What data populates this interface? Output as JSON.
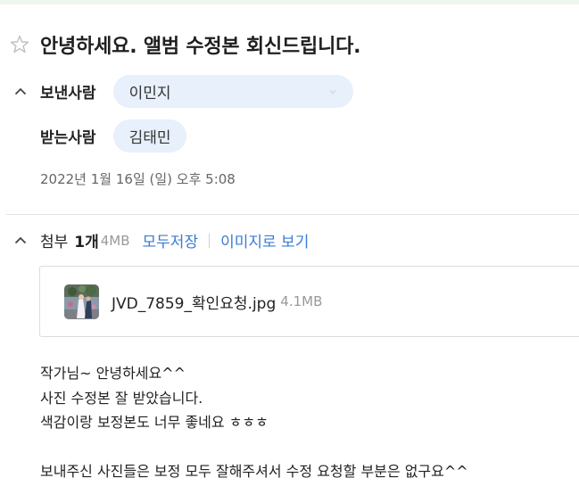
{
  "mail": {
    "subject": "안녕하세요. 앨범 수정본 회신드립니다.",
    "sender_label": "보낸사람",
    "sender_name": "이민지",
    "recipient_label": "받는사람",
    "recipient_name": "김태민",
    "date": "2022년 1월 16일 (일) 오후 5:08"
  },
  "attachments": {
    "title": "첨부",
    "count": "1개",
    "total_size": "4MB",
    "save_all_label": "모두저장",
    "image_view_label": "이미지로 보기",
    "files": [
      {
        "name": "JVD_7859_확인요청.jpg",
        "size": "4.1MB"
      }
    ]
  },
  "body": {
    "lines": [
      "작가님~ 안녕하세요^^",
      "사진 수정본 잘 받았습니다.",
      "색감이랑 보정본도 너무 좋네요 ㅎㅎㅎ",
      "",
      "보내주신 사진들은 보정 모두 잘해주셔서 수정 요청할 부분은 없구요^^"
    ]
  },
  "icons": {
    "star": "star-outline-icon",
    "chevron": "chevron-up-icon"
  },
  "colors": {
    "accent": "#3a7bd5",
    "pill_bg": "#e7f0fb",
    "top_strip": "#eef7ee"
  }
}
